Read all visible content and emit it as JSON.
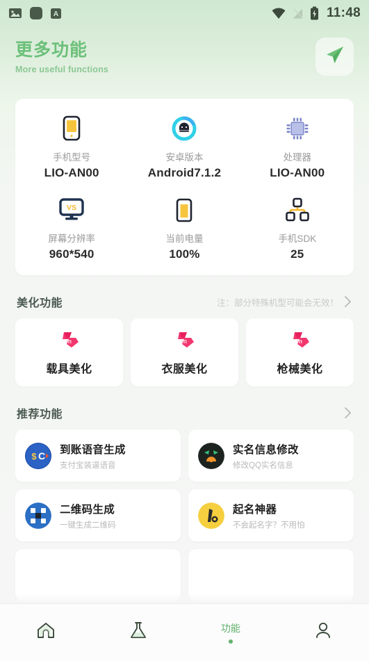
{
  "status_bar": {
    "time": "11:48",
    "left_icons": [
      "image-icon",
      "app-square-icon",
      "a-badge-icon"
    ],
    "right_icons": [
      "wifi-icon",
      "signal-off-icon",
      "battery-charging-icon"
    ]
  },
  "header": {
    "title": "更多功能",
    "subtitle": "More useful functions",
    "action_icon": "send-icon",
    "accent_color": "#6cc07a"
  },
  "device_info": {
    "rows": [
      [
        {
          "icon": "phone-icon",
          "label": "手机型号",
          "value": "LIO-AN00"
        },
        {
          "icon": "android-icon",
          "label": "安卓版本",
          "value": "Android7.1.2"
        },
        {
          "icon": "cpu-chip-icon",
          "label": "处理器",
          "value": "LIO-AN00"
        }
      ],
      [
        {
          "icon": "monitor-vs-icon",
          "label": "屏幕分辨率",
          "value": "960*540"
        },
        {
          "icon": "battery-icon",
          "label": "当前电量",
          "value": "100%"
        },
        {
          "icon": "sitemap-icon",
          "label": "手机SDK",
          "value": "25"
        }
      ]
    ]
  },
  "beautify_section": {
    "title": "美化功能",
    "note": "注：部分特殊机型可能会无效！",
    "chevron_icon": "chevron-right-icon",
    "cards": [
      {
        "icon": "m-logo-icon",
        "label": "载具美化"
      },
      {
        "icon": "m-logo-icon",
        "label": "衣服美化"
      },
      {
        "icon": "m-logo-icon",
        "label": "枪械美化"
      }
    ]
  },
  "recommend_section": {
    "title": "推荐功能",
    "chevron_icon": "chevron-right-icon",
    "cards": [
      {
        "icon": "alipay-coin-icon",
        "title": "到账语音生成",
        "subtitle": "支付宝装逼语音"
      },
      {
        "icon": "qq-penguin-icon",
        "title": "实名信息修改",
        "subtitle": "修改QQ实名信息"
      },
      {
        "icon": "qrcode-icon",
        "title": "二维码生成",
        "subtitle": "一键生成二维码"
      },
      {
        "icon": "name-pen-icon",
        "title": "起名神器",
        "subtitle": "不会起名字？不用怕"
      }
    ]
  },
  "tab_bar": {
    "tabs": [
      {
        "icon": "home-icon",
        "label": "",
        "active": false
      },
      {
        "icon": "flask-icon",
        "label": "",
        "active": false
      },
      {
        "icon": "",
        "label": "功能",
        "active": true
      },
      {
        "icon": "person-icon",
        "label": "",
        "active": false
      }
    ],
    "active_color": "#63b26f"
  }
}
